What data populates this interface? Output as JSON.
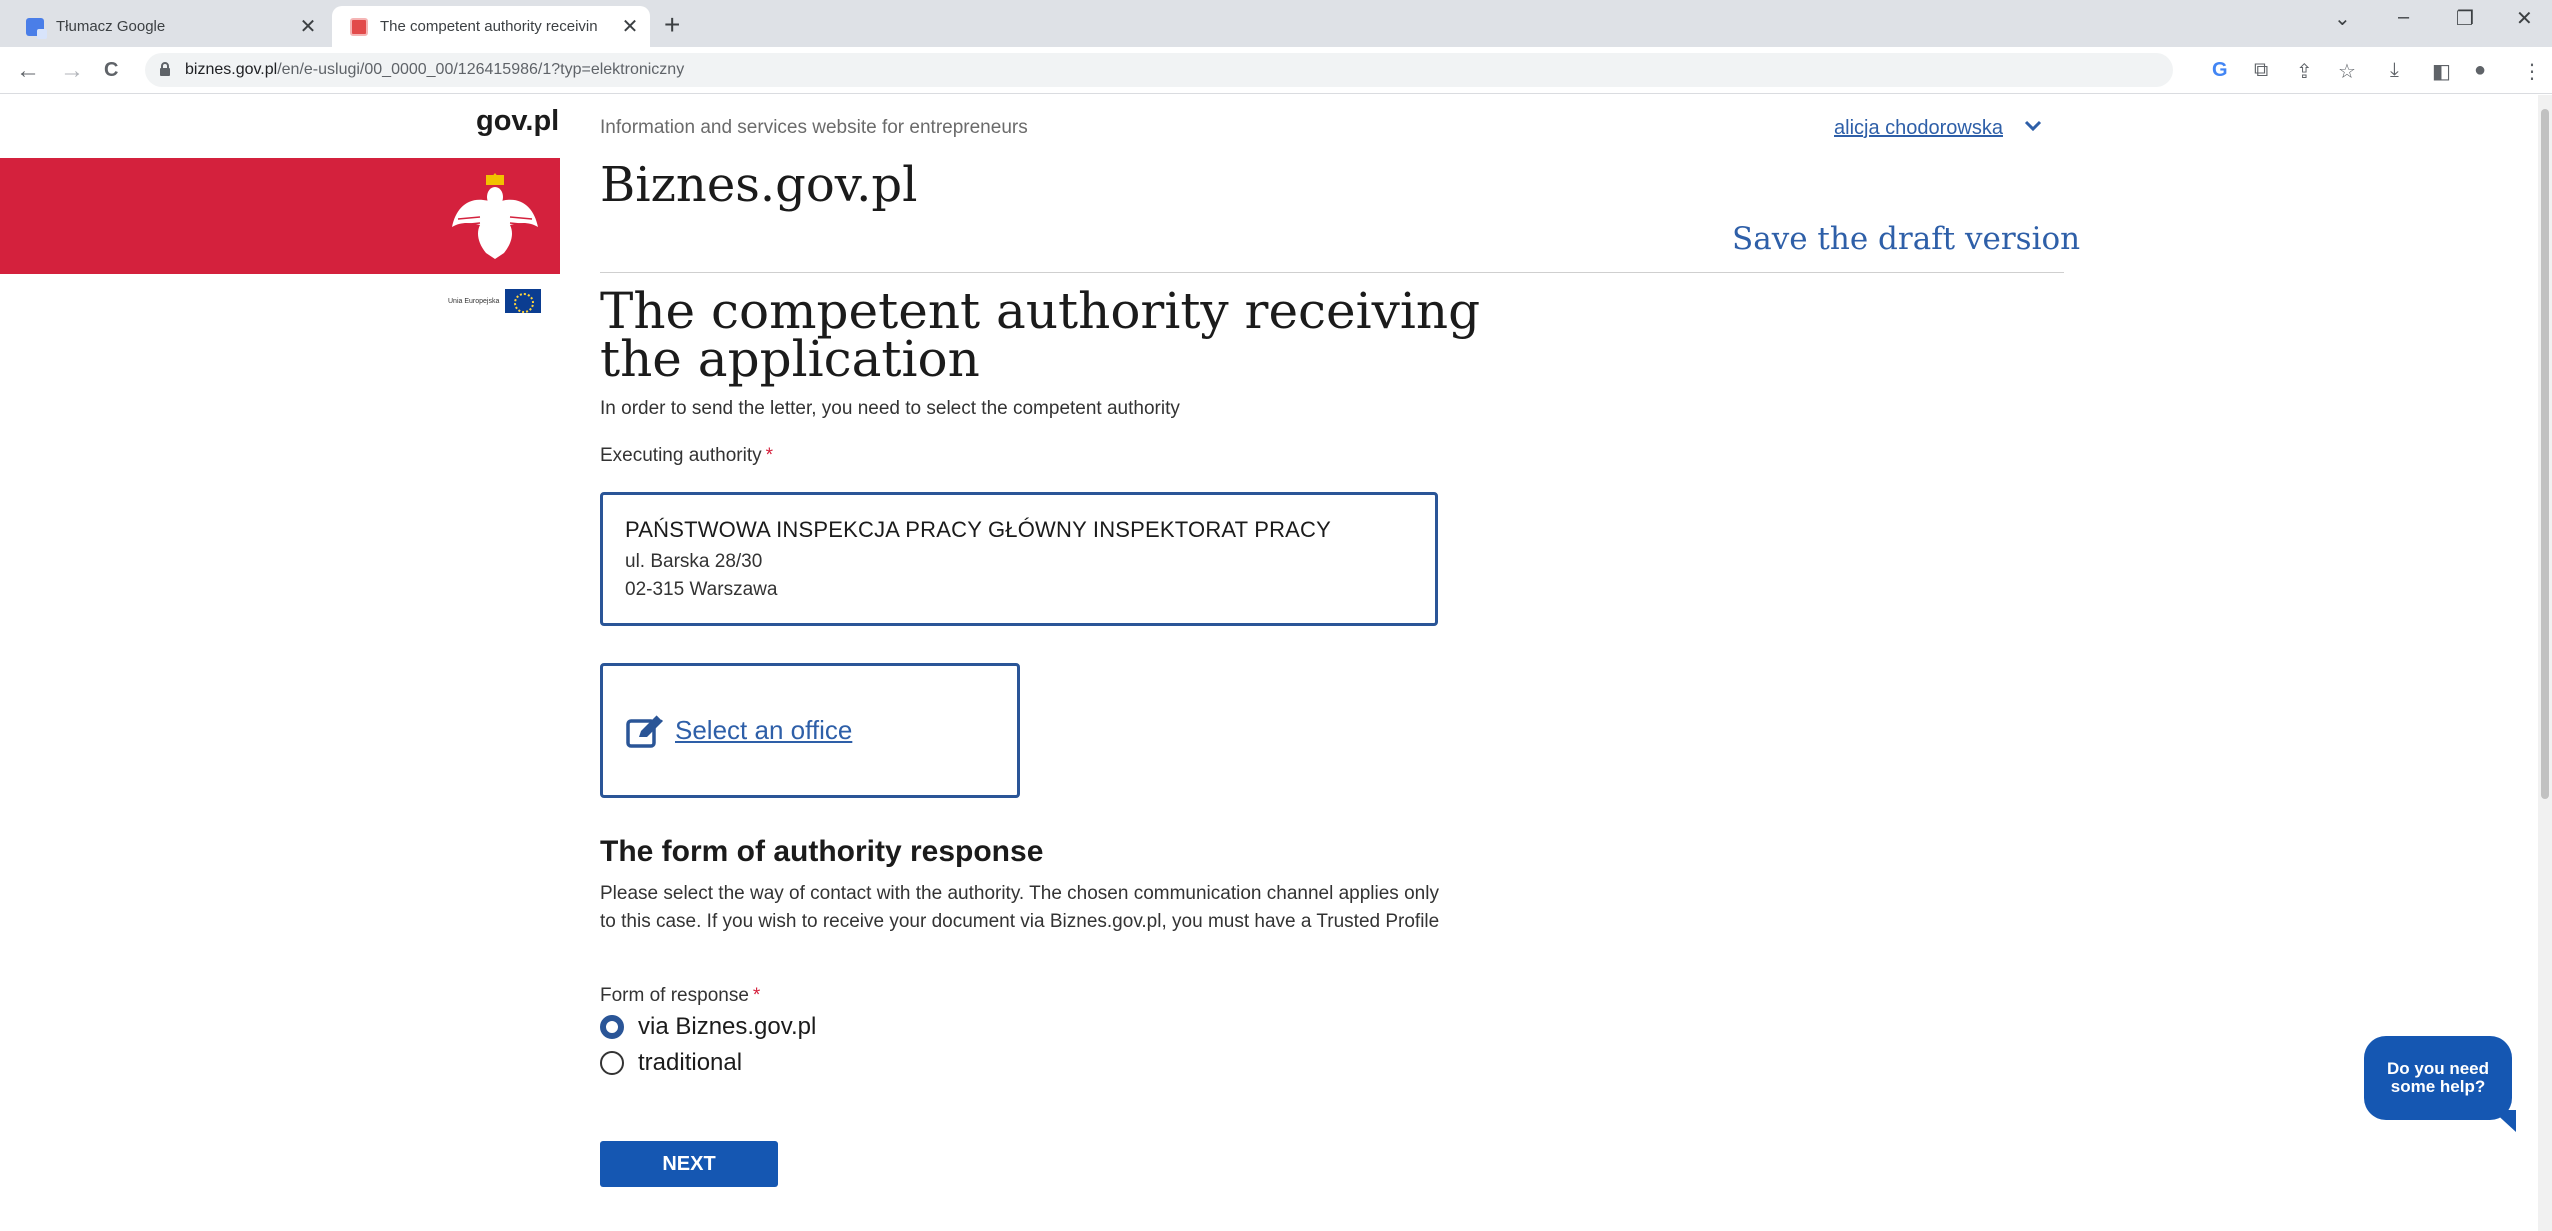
{
  "browser": {
    "tabs": [
      {
        "title": "Tłumacz Google",
        "close": "✕"
      },
      {
        "title": "The competent authority receivin",
        "close": "✕"
      }
    ],
    "new_tab": "+",
    "window_controls": {
      "down": "⌄",
      "minimize": "–",
      "restore": "❐",
      "close": "✕"
    },
    "nav": {
      "back": "←",
      "forward": "→",
      "reload": "C"
    },
    "url_domain": "biznes.gov.pl",
    "url_path": "/en/e-uslugi/00_0000_00/126415986/1?typ=elektroniczny"
  },
  "header": {
    "gov_logo": "gov.pl",
    "eu_label": "Unia Europejska",
    "info_text": "Information and services website for entrepreneurs",
    "site_name": "Biznes.gov.pl",
    "user_name": "alicja chodorowska",
    "save_draft": "Save the draft version"
  },
  "main": {
    "title": "The competent authority receiving the application",
    "intro": "In order to send the letter, you need to select the competent authority",
    "executing_label": "Executing authority",
    "required_mark": "*",
    "authority": {
      "name": "PAŃSTWOWA INSPEKCJA PRACY GŁÓWNY INSPEKTORAT PRACY",
      "street": "ul. Barska 28/30",
      "city": "02-315 Warszawa"
    },
    "select_office": "Select an office",
    "response_heading": "The form of authority response",
    "response_desc": "Please select the way of contact with the authority. The chosen communication channel applies only to this case. If you wish to receive your document via Biznes.gov.pl, you must have a Trusted Profile",
    "form_label": "Form of response",
    "options": [
      {
        "label": "via Biznes.gov.pl",
        "selected": true
      },
      {
        "label": "traditional",
        "selected": false
      }
    ],
    "next_button": "NEXT"
  },
  "help_bubble": "Do you need some help?",
  "colors": {
    "accent": "#1557b2",
    "link": "#2e5fa8",
    "brand_red": "#d4213d"
  }
}
